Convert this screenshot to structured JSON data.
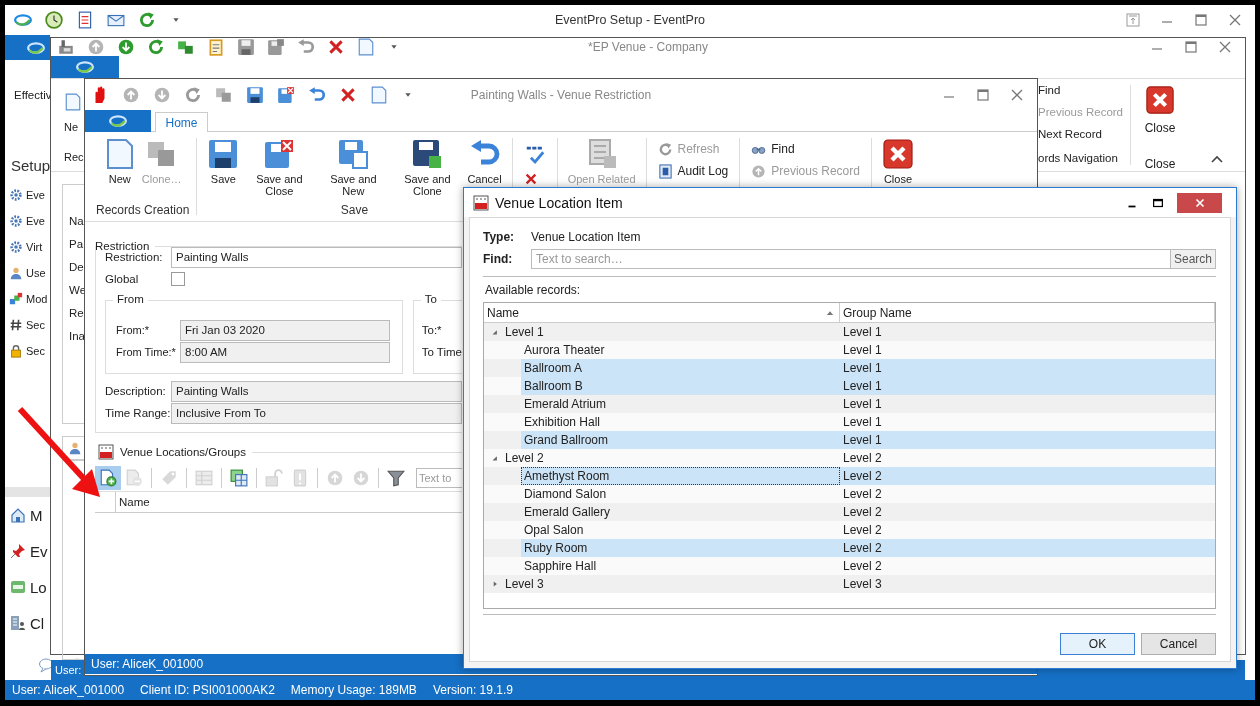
{
  "main_window": {
    "title": "EventPro Setup - EventPro",
    "ribbon_text": "Effectiv",
    "sidebar": {
      "title": "Setup",
      "items": [
        {
          "label": "Eve"
        },
        {
          "label": "Eve"
        },
        {
          "label": "Virt"
        },
        {
          "label": "Use"
        },
        {
          "label": "Mod"
        },
        {
          "label": "Sec"
        },
        {
          "label": "Sec"
        }
      ]
    },
    "nav_items": [
      {
        "label": "M"
      },
      {
        "label": "Ev"
      },
      {
        "label": "Lo"
      },
      {
        "label": "Cl"
      }
    ],
    "status_bar": [
      "User: AliceK_001000",
      "Client ID: PSI001000AK2",
      "Memory Usage: 189MB",
      "Version: 19.1.9"
    ]
  },
  "venue_window": {
    "title": "*EP Venue - Company",
    "ribbon_left": {
      "button": "Ne",
      "group_label": "Rec"
    },
    "navigation": {
      "items": [
        {
          "label": "Find",
          "disabled": false
        },
        {
          "label": "Previous Record",
          "disabled": true
        },
        {
          "label": "Next Record",
          "disabled": false
        }
      ],
      "group_label": "ords Navigation"
    },
    "close": {
      "button": "Close",
      "group_label": "Close"
    },
    "form_labels": [
      "Na",
      "Pa",
      "De",
      "We",
      "Re",
      "Ina"
    ],
    "status_bar": "User:"
  },
  "restriction_window": {
    "title": "Painting Walls - Venue Restriction",
    "tabs": [
      {
        "label": "Home",
        "selected": true
      }
    ],
    "ribbon_groups": [
      {
        "kind": "large",
        "label": "Records Creation",
        "buttons": [
          {
            "label": "New",
            "disabled": false
          },
          {
            "label": "Clone…",
            "disabled": true
          }
        ]
      },
      {
        "kind": "large",
        "label": "Save",
        "buttons": [
          {
            "label": "Save",
            "disabled": false
          },
          {
            "label": "Save and Close",
            "disabled": false
          },
          {
            "label": "Save and New",
            "disabled": false
          },
          {
            "label": "Save and Clone",
            "disabled": false
          },
          {
            "label": "Cancel",
            "disabled": false
          }
        ]
      },
      {
        "kind": "icons"
      },
      {
        "kind": "large",
        "buttons": [
          {
            "label": "Open Related",
            "disabled": true
          }
        ]
      },
      {
        "kind": "small",
        "buttons": [
          {
            "label": "Refresh",
            "disabled": true
          },
          {
            "label": "Audit Log",
            "disabled": false
          }
        ]
      },
      {
        "kind": "small",
        "buttons": [
          {
            "label": "Find",
            "disabled": false
          },
          {
            "label": "Previous Record",
            "disabled": true
          }
        ]
      },
      {
        "kind": "large",
        "buttons": [
          {
            "label": "Close",
            "disabled": false
          }
        ]
      }
    ],
    "restriction_group": {
      "legend": "Restriction",
      "fields": [
        {
          "label": "Restriction:",
          "value": "Painting Walls",
          "readonly": false
        }
      ],
      "global": {
        "label": "Global",
        "checked": false
      },
      "from": {
        "legend": "From",
        "fields": [
          {
            "label": "From:*",
            "value": "Fri Jan 03 2020",
            "readonly": true
          },
          {
            "label": "From Time:*",
            "value": "8:00 AM",
            "readonly": true
          }
        ]
      },
      "to": {
        "legend": "To",
        "labels": [
          "To:*",
          "To Time"
        ]
      },
      "more_fields": [
        {
          "label": "Description:",
          "value": "Painting Walls",
          "readonly": true
        },
        {
          "label": "Time Range:",
          "value": "Inclusive From To",
          "readonly": true
        }
      ]
    },
    "venue_locations": {
      "title": "Venue Locations/Groups",
      "tools": [
        {
          "highlighted": true,
          "disabled": false
        },
        {
          "highlighted": false,
          "disabled": true
        },
        {
          "highlighted": false,
          "disabled": true
        },
        {
          "highlighted": false,
          "disabled": true
        },
        {
          "highlighted": false,
          "disabled": false
        },
        {
          "highlighted": false,
          "disabled": true
        },
        {
          "highlighted": false,
          "disabled": true
        },
        {
          "highlighted": false,
          "disabled": true
        },
        {
          "highlighted": false,
          "disabled": true
        },
        {
          "highlighted": false,
          "disabled": false
        }
      ],
      "search_placeholder": "Text to",
      "columns": [
        "Name"
      ]
    },
    "status_bar": "User: AliceK_001000"
  },
  "dialog": {
    "title": "Venue Location Item",
    "type_label": "Type:",
    "type_value": "Venue Location Item",
    "find_label": "Find:",
    "find_placeholder": "Text to search…",
    "search_button": "Search",
    "available_label": "Available records:",
    "columns": [
      {
        "label": "Name",
        "sorted": true
      },
      {
        "label": "Group Name",
        "sorted": false
      }
    ],
    "rows": [
      {
        "name": "Level 1",
        "group_name": "Level 1",
        "expanded": true,
        "children": [
          {
            "name": "Aurora Theater",
            "group_name": "Level 1",
            "selected": false,
            "focused": false
          },
          {
            "name": "Ballroom A",
            "group_name": "Level 1",
            "selected": true,
            "focused": false
          },
          {
            "name": "Ballroom B",
            "group_name": "Level 1",
            "selected": true,
            "focused": false
          },
          {
            "name": "Emerald Atrium",
            "group_name": "Level 1",
            "selected": false,
            "focused": false
          },
          {
            "name": "Exhibition Hall",
            "group_name": "Level 1",
            "selected": false,
            "focused": false
          },
          {
            "name": "Grand Ballroom",
            "group_name": "Level 1",
            "selected": true,
            "focused": false
          }
        ]
      },
      {
        "name": "Level 2",
        "group_name": "Level 2",
        "expanded": true,
        "children": [
          {
            "name": "Amethyst Room",
            "group_name": "Level 2",
            "selected": true,
            "focused": true
          },
          {
            "name": "Diamond Salon",
            "group_name": "Level 2",
            "selected": false,
            "focused": false
          },
          {
            "name": "Emerald Gallery",
            "group_name": "Level 2",
            "selected": false,
            "focused": false
          },
          {
            "name": "Opal Salon",
            "group_name": "Level 2",
            "selected": false,
            "focused": false
          },
          {
            "name": "Ruby Room",
            "group_name": "Level 2",
            "selected": true,
            "focused": false
          },
          {
            "name": "Sapphire Hall",
            "group_name": "Level 2",
            "selected": false,
            "focused": false
          }
        ]
      },
      {
        "name": "Level 3",
        "group_name": "Level 3",
        "expanded": false
      }
    ],
    "buttons": [
      {
        "label": "OK",
        "default": true
      },
      {
        "label": "Cancel",
        "default": false
      }
    ]
  }
}
